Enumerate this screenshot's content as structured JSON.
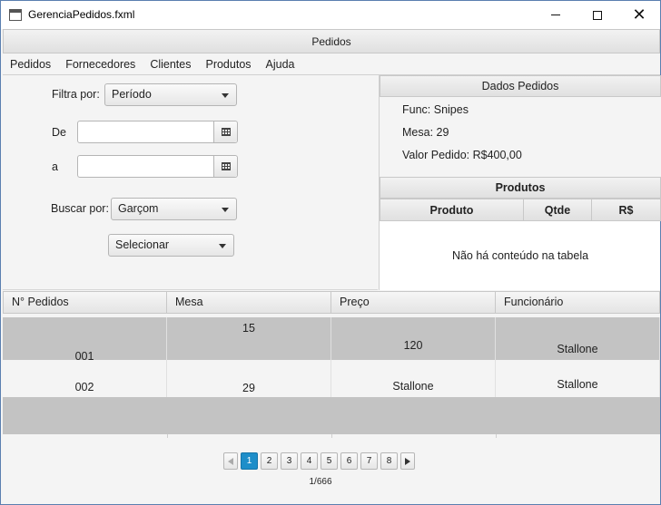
{
  "window": {
    "title": "GerenciaPedidos.fxml"
  },
  "header": {
    "title": "Pedidos"
  },
  "menu": [
    "Pedidos",
    "Fornecedores",
    "Clientes",
    "Produtos",
    "Ajuda"
  ],
  "filters": {
    "filtra_label": "Filtra por:",
    "filtra_value": "Período",
    "de_label": "De",
    "de_value": "",
    "a_label": "a",
    "a_value": "",
    "buscar_label": "Buscar por:",
    "buscar_value": "Garçom",
    "selecionar_value": "Selecionar"
  },
  "dados": {
    "title": "Dados Pedidos",
    "func": "Func: Snipes",
    "mesa": "Mesa: 29",
    "valor": "Valor Pedido: R$400,00"
  },
  "produtos": {
    "title": "Produtos",
    "columns": [
      "Produto",
      "Qtde",
      "R$"
    ],
    "empty_text": "Não há conteúdo na tabela"
  },
  "pedidos_table": {
    "columns": [
      "N° Pedidos",
      "Mesa",
      "Preço",
      "Funcionário"
    ],
    "rows": [
      [
        "001",
        "15",
        "120",
        "Stallone"
      ],
      [
        "002",
        "29",
        "Stallone",
        "Stallone"
      ]
    ]
  },
  "pagination": {
    "pages": [
      "1",
      "2",
      "3",
      "4",
      "5",
      "6",
      "7",
      "8"
    ],
    "current": "1",
    "count_text": "1/666",
    "active_color": "#1e8ec9"
  }
}
